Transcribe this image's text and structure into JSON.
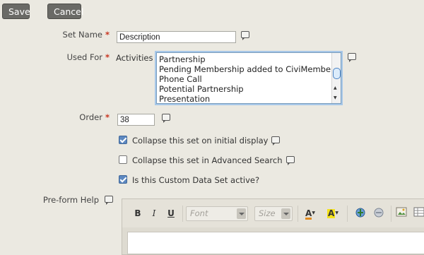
{
  "buttons": {
    "save": "Save",
    "cancel": "Cancel"
  },
  "form": {
    "set_name": {
      "label": "Set Name",
      "required": "*",
      "value": "Description"
    },
    "used_for": {
      "label": "Used For",
      "required": "*",
      "entity": "Activities",
      "options": [
        "Partnership",
        "Pending Membership added to CiviMember",
        "Phone Call",
        "Potential Partnership",
        "Presentation"
      ]
    },
    "order": {
      "label": "Order",
      "required": "*",
      "value": "38"
    },
    "checkboxes": [
      {
        "label": "Collapse this set on initial display",
        "checked": true
      },
      {
        "label": "Collapse this set in Advanced Search",
        "checked": false
      },
      {
        "label": "Is this Custom Data Set active?",
        "checked": true
      }
    ],
    "preform_help": {
      "label": "Pre-form Help"
    }
  },
  "editor": {
    "bold": "B",
    "italic": "I",
    "underline": "U",
    "font_placeholder": "Font",
    "size_placeholder": "Size",
    "text_color_glyph": "A",
    "bg_color_glyph": "A",
    "colors": {
      "text_color": "#e08a1e",
      "bg_color": "#f4e21a"
    }
  }
}
